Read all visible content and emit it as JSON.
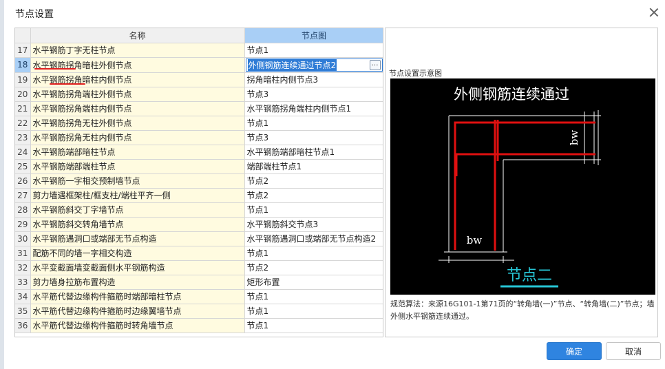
{
  "dialog": {
    "title": "节点设置",
    "ok_label": "确定",
    "cancel_label": "取消"
  },
  "grid": {
    "headers": {
      "name": "名称",
      "node": "节点图"
    },
    "rows": [
      {
        "num": "17",
        "name": "水平钢筋丁字无柱节点",
        "node": "节点1"
      },
      {
        "num": "18",
        "name": "水平钢筋拐角暗柱外侧节点",
        "node": "外侧钢筋连续通过节点2"
      },
      {
        "num": "19",
        "name": "水平钢筋拐角暗柱内侧节点",
        "node": "拐角暗柱内侧节点3"
      },
      {
        "num": "20",
        "name": "水平钢筋拐角端柱外侧节点",
        "node": "节点3"
      },
      {
        "num": "21",
        "name": "水平钢筋拐角端柱内侧节点",
        "node": "水平钢筋拐角端柱内侧节点1"
      },
      {
        "num": "22",
        "name": "水平钢筋拐角无柱外侧节点",
        "node": "节点1"
      },
      {
        "num": "23",
        "name": "水平钢筋拐角无柱内侧节点",
        "node": "节点3"
      },
      {
        "num": "24",
        "name": "水平钢筋端部暗柱节点",
        "node": "水平钢筋端部暗柱节点1"
      },
      {
        "num": "25",
        "name": "水平钢筋端部端柱节点",
        "node": "端部端柱节点1"
      },
      {
        "num": "26",
        "name": "水平钢筋一字相交预制墙节点",
        "node": "节点2"
      },
      {
        "num": "27",
        "name": "剪力墙遇框架柱/框支柱/端柱平齐一侧",
        "node": "节点2"
      },
      {
        "num": "28",
        "name": "水平钢筋斜交丁字墙节点",
        "node": "节点1"
      },
      {
        "num": "29",
        "name": "水平钢筋斜交转角墙节点",
        "node": "水平钢筋斜交节点3"
      },
      {
        "num": "30",
        "name": "水平钢筋遇洞口或端部无节点构造",
        "node": "水平钢筋遇洞口或端部无节点构造2"
      },
      {
        "num": "31",
        "name": "配筋不同的墙一字相交构造",
        "node": "节点1"
      },
      {
        "num": "32",
        "name": "水平变截面墙变截面侧水平钢筋构造",
        "node": "节点2"
      },
      {
        "num": "33",
        "name": "剪力墙身拉筋布置构造",
        "node": "矩形布置"
      },
      {
        "num": "34",
        "name": "水平筋代替边缘构件箍筋时端部暗柱节点",
        "node": "节点1"
      },
      {
        "num": "35",
        "name": "水平筋代替边缘构件箍筋时边缘翼墙节点",
        "node": "节点1"
      },
      {
        "num": "36",
        "name": "水平筋代替边缘构件箍筋时转角墙节点",
        "node": "节点1"
      }
    ],
    "active_row": 1,
    "edit_button": "…"
  },
  "preview": {
    "label": "节点设置示意图",
    "diagram_title": "外侧钢筋连续通过",
    "dim_label": "bw",
    "caption": "节点二",
    "description": "规范算法：来源16G101-1第71页的“转角墙(一)”节点、“转角墙(二)”节点；墙外侧水平钢筋连续通过。"
  },
  "colors": {
    "accent": "#2f84e0",
    "rebar": "#e01010",
    "caption": "#27c6d6",
    "name_cell_bg": "#fffbe0"
  }
}
